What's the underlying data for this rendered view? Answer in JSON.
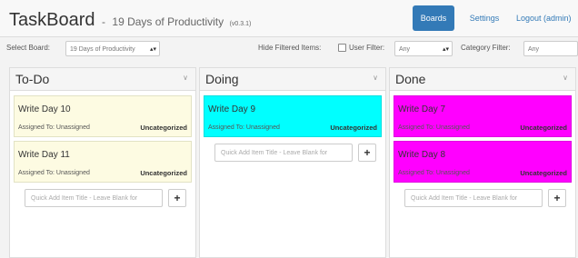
{
  "app": {
    "name": "TaskBoard",
    "separator": "-",
    "board_name": "19 Days of Productivity",
    "version": "(v0.3.1)"
  },
  "nav": {
    "boards": "Boards",
    "settings": "Settings",
    "logout": "Logout (admin)"
  },
  "filters": {
    "select_board_label": "Select Board:",
    "select_board_value": "19 Days of Productivity",
    "hide_filtered_label": "Hide Filtered Items:",
    "user_filter_label": "User Filter:",
    "user_filter_value": "Any",
    "category_filter_label": "Category Filter:",
    "category_filter_value": "Any"
  },
  "quick_add_placeholder": "Quick Add Item Title - Leave Blank for",
  "quick_add_button": "+",
  "colors": {
    "todo_card": "#fdfbe2",
    "doing_card": "#00ffff",
    "done_card": "#ff00ff",
    "primary": "#337ab7"
  },
  "columns": [
    {
      "title": "To-Do",
      "caret": "∨",
      "cards": [
        {
          "title": "Write Day 10",
          "assigned": "Assigned To: Unassigned",
          "category": "Uncategorized"
        },
        {
          "title": "Write Day 11",
          "assigned": "Assigned To: Unassigned",
          "category": "Uncategorized"
        }
      ]
    },
    {
      "title": "Doing",
      "caret": "∨",
      "cards": [
        {
          "title": "Write Day 9",
          "assigned": "Assigned To: Unassigned",
          "category": "Uncategorized"
        }
      ]
    },
    {
      "title": "Done",
      "caret": "∨",
      "cards": [
        {
          "title": "Write Day 7",
          "assigned": "Assigned To: Unassigned",
          "category": "Uncategorized"
        },
        {
          "title": "Write Day 8",
          "assigned": "Assigned To: Unassigned",
          "category": "Uncategorized"
        }
      ]
    }
  ]
}
